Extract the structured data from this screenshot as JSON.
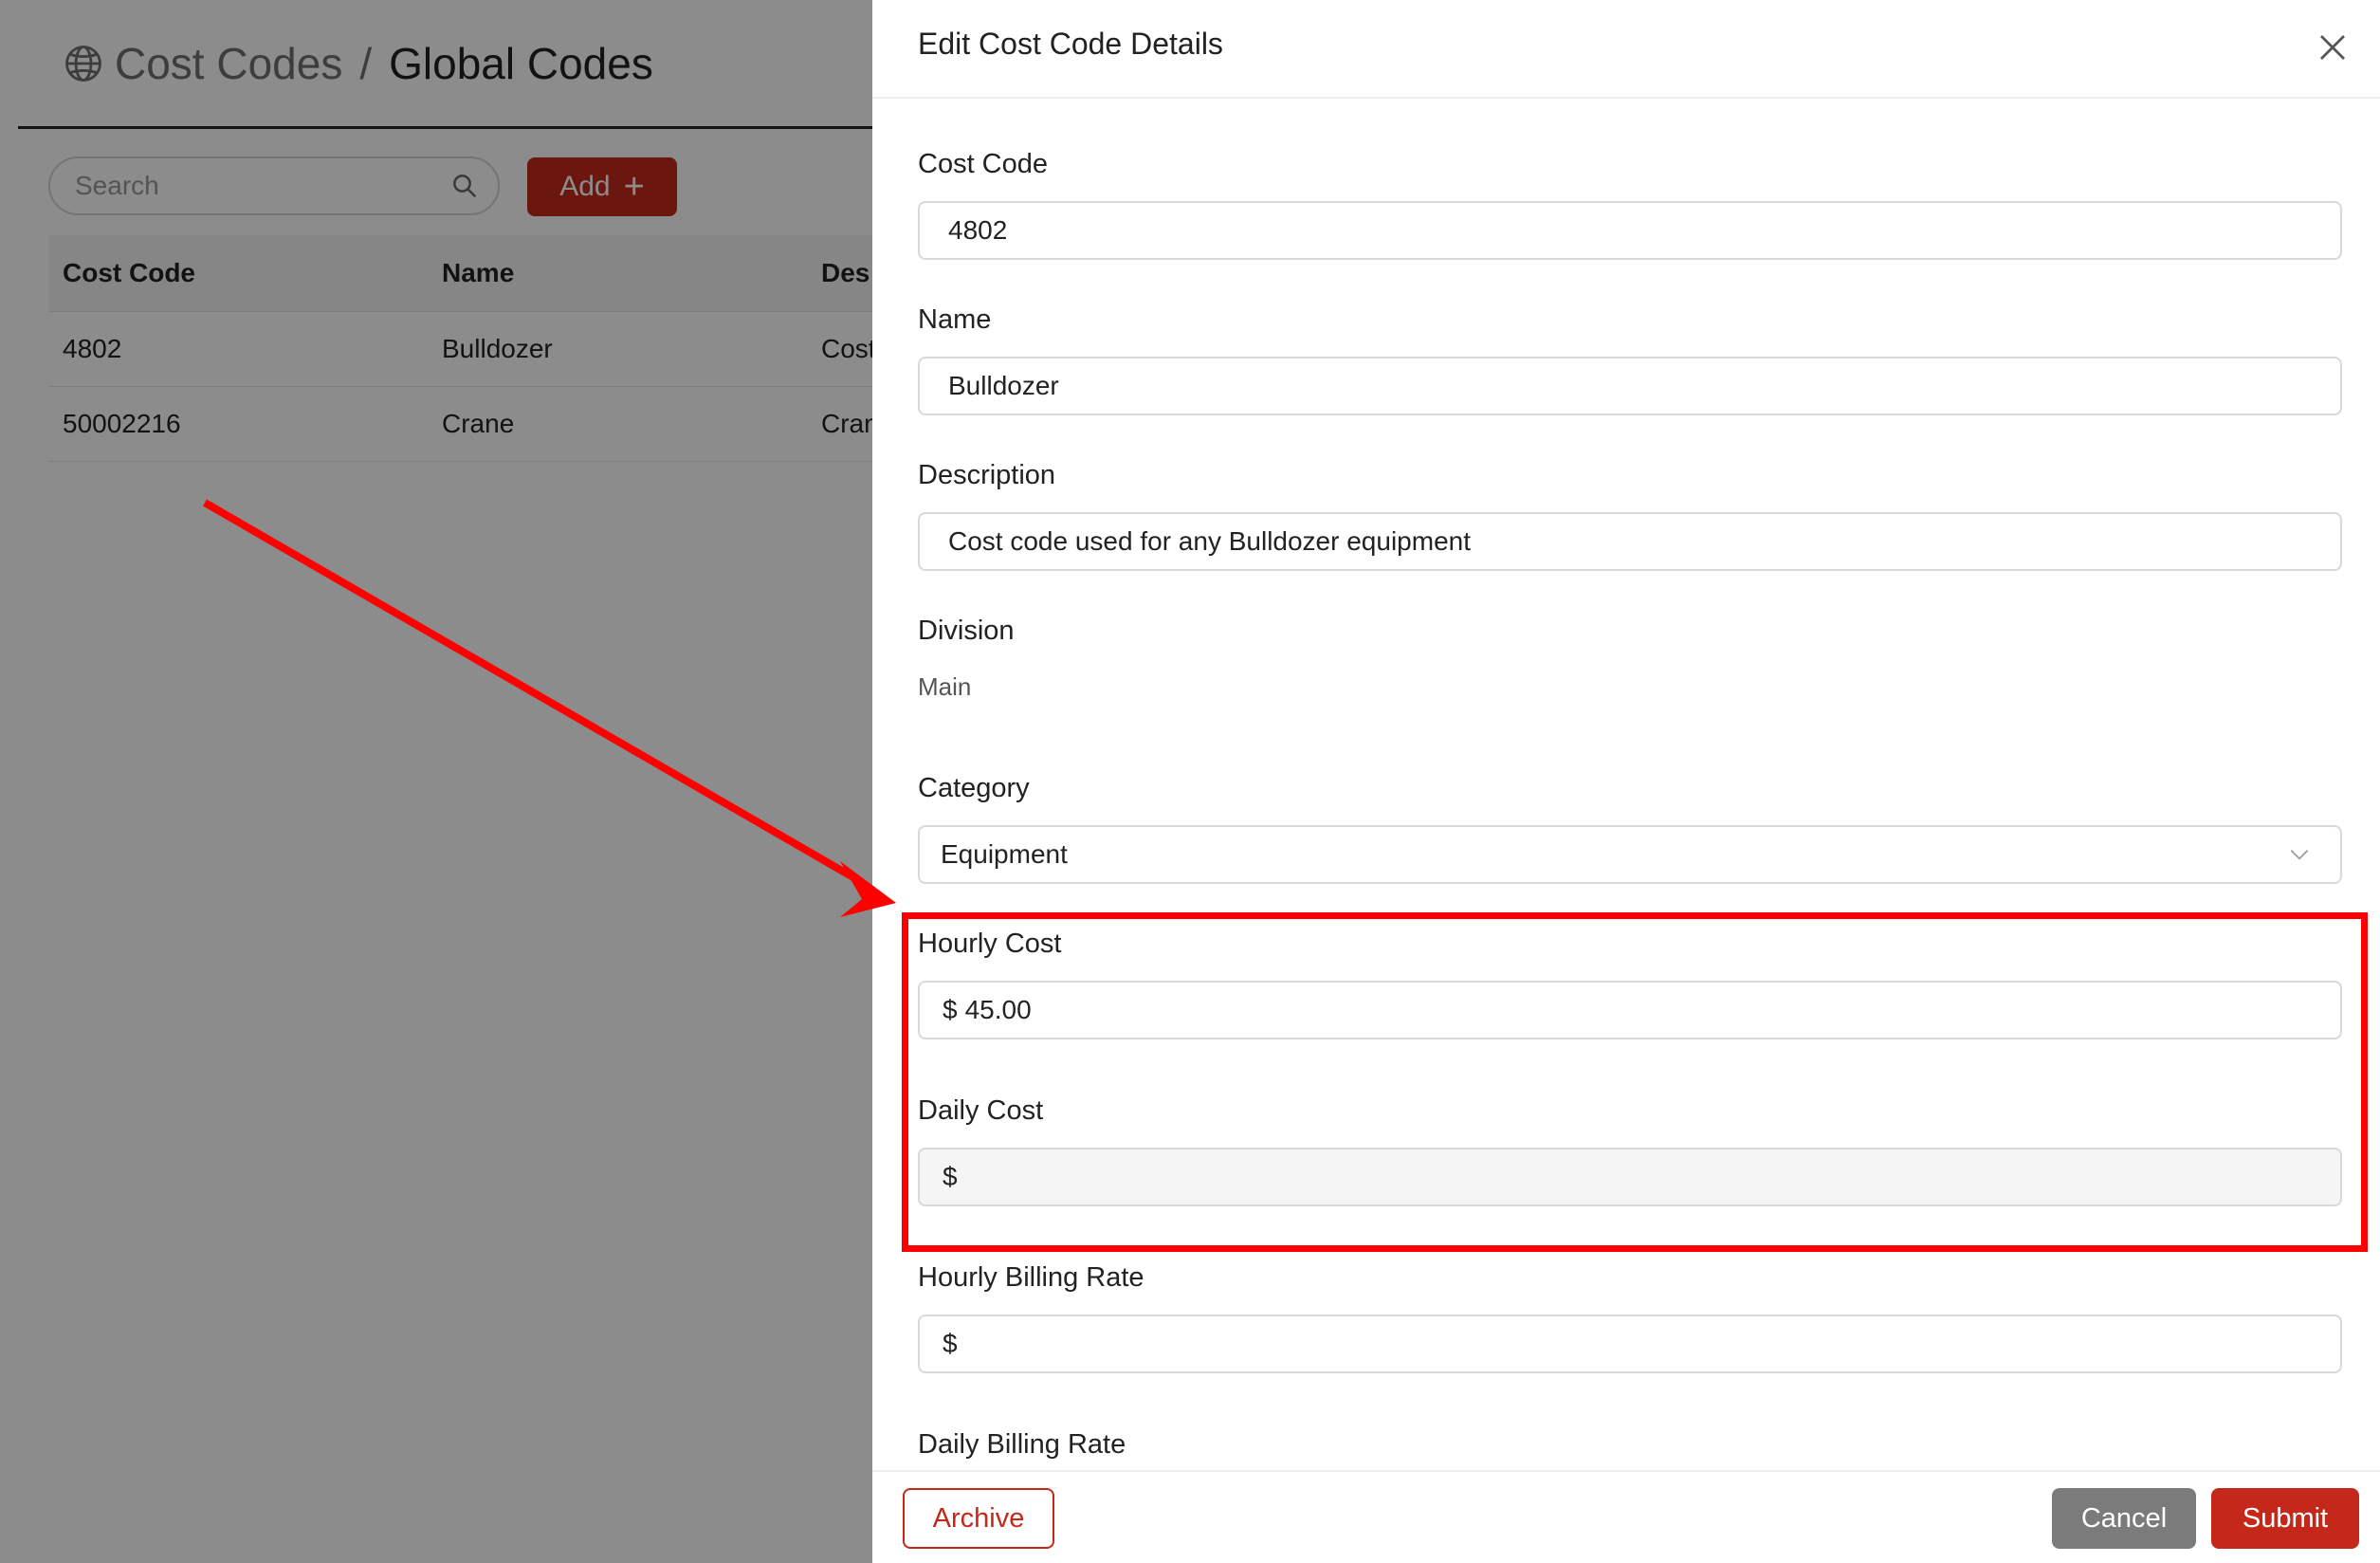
{
  "page": {
    "breadcrumb": {
      "parent": "Cost Codes",
      "separator": "/",
      "current": "Global Codes"
    },
    "search": {
      "placeholder": "Search",
      "value": ""
    },
    "add_label": "Add",
    "table": {
      "headers": [
        "Cost Code",
        "Name",
        "Des"
      ],
      "rows": [
        [
          "4802",
          "Bulldozer",
          "Cost"
        ],
        [
          "50002216",
          "Crane",
          "Cran"
        ]
      ]
    }
  },
  "drawer": {
    "title": "Edit Cost Code Details",
    "fields": {
      "cost_code": {
        "label": "Cost Code",
        "value": "4802"
      },
      "name": {
        "label": "Name",
        "value": "Bulldozer"
      },
      "description": {
        "label": "Description",
        "value": "Cost code used for any Bulldozer equipment"
      },
      "division": {
        "label": "Division",
        "value": "Main"
      },
      "category": {
        "label": "Category",
        "value": "Equipment"
      },
      "hourly_cost": {
        "label": "Hourly Cost",
        "prefix": "$",
        "value": "45.00"
      },
      "daily_cost": {
        "label": "Daily Cost",
        "prefix": "$",
        "value": ""
      },
      "hourly_billing_rate": {
        "label": "Hourly Billing Rate",
        "prefix": "$",
        "value": ""
      },
      "daily_billing_rate": {
        "label": "Daily Billing Rate"
      }
    },
    "footer": {
      "archive_label": "Archive",
      "cancel_label": "Cancel",
      "submit_label": "Submit"
    }
  },
  "colors": {
    "brand_red": "#c4281b",
    "cancel_gray": "#7b7b7b",
    "annotation_red": "#ff0000",
    "overlay": "rgba(0,0,0,0.45)"
  },
  "icons": [
    "globe-icon",
    "search-icon",
    "plus-icon",
    "close-icon",
    "chevron-down-icon"
  ]
}
